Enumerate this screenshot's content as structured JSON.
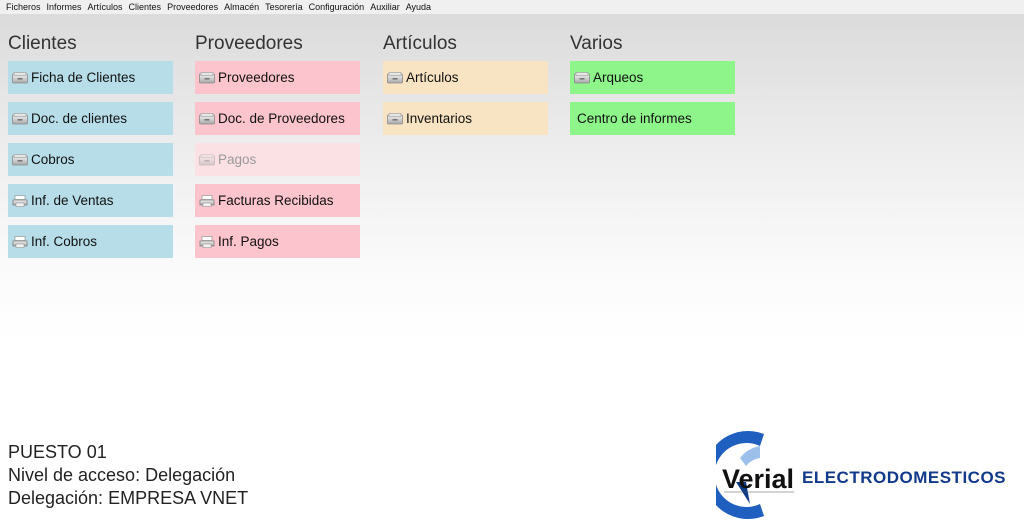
{
  "menu": [
    "Ficheros",
    "Informes",
    "Artículos",
    "Clientes",
    "Proveedores",
    "Almacén",
    "Tesorería",
    "Configuración",
    "Auxiliar",
    "Ayuda"
  ],
  "columns": [
    {
      "title": "Clientes",
      "color": "blue",
      "tiles": [
        {
          "label": "Ficha de Clientes",
          "icon": "drawer-icon"
        },
        {
          "label": "Doc. de clientes",
          "icon": "drawer-icon"
        },
        {
          "label": "Cobros",
          "icon": "drawer-icon"
        },
        {
          "label": "Inf. de Ventas",
          "icon": "printer-icon"
        },
        {
          "label": "Inf. Cobros",
          "icon": "printer-icon"
        }
      ]
    },
    {
      "title": "Proveedores",
      "color": "pink",
      "tiles": [
        {
          "label": "Proveedores",
          "icon": "drawer-icon"
        },
        {
          "label": "Doc. de Proveedores",
          "icon": "drawer-icon"
        },
        {
          "label": "Pagos",
          "icon": "drawer-icon",
          "disabled": true
        },
        {
          "label": "Facturas Recibidas",
          "icon": "printer-icon"
        },
        {
          "label": "Inf. Pagos",
          "icon": "printer-icon"
        }
      ]
    },
    {
      "title": "Artículos",
      "color": "orange",
      "tiles": [
        {
          "label": "Artículos",
          "icon": "drawer-icon"
        },
        {
          "label": "Inventarios",
          "icon": "drawer-icon"
        }
      ]
    },
    {
      "title": "Varios",
      "color": "green",
      "tiles": [
        {
          "label": "Arqueos",
          "icon": "drawer-icon"
        },
        {
          "label": "Centro de informes",
          "icon": ""
        }
      ]
    }
  ],
  "status": {
    "puesto": "PUESTO 01",
    "nivel": "Nivel de acceso: Delegación",
    "delegacion": "Delegación: EMPRESA VNET"
  },
  "logo": {
    "brand": "Verial",
    "sub": "ELECTRODOMESTICOS",
    "colors": [
      "#1f5fbf",
      "#003a8c"
    ]
  }
}
